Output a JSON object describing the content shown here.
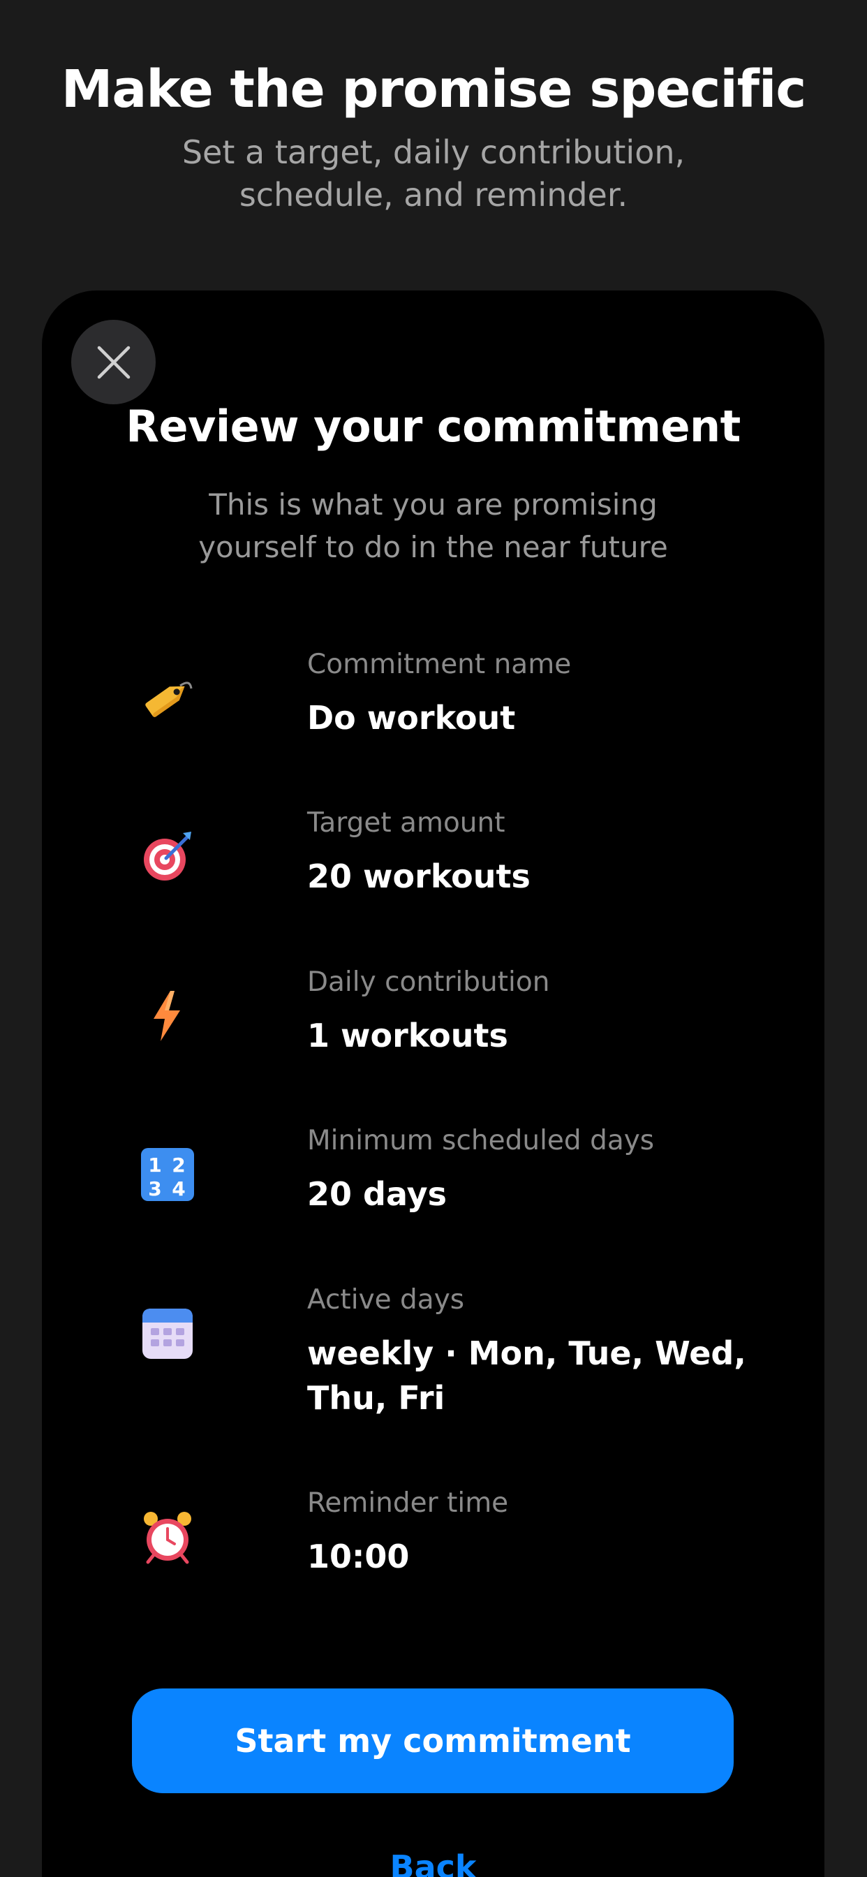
{
  "header": {
    "title": "Make the promise specific",
    "subtitle": "Set a target, daily contribution, schedule, and reminder."
  },
  "sheet": {
    "title": "Review your commitment",
    "subtitle": "This is what you are promising yourself to do in the near future",
    "rows": [
      {
        "icon": "tag-icon",
        "label": "Commitment name",
        "value": "Do workout"
      },
      {
        "icon": "target-icon",
        "label": "Target amount",
        "value": "20 workouts"
      },
      {
        "icon": "lightning-icon",
        "label": "Daily contribution",
        "value": "1 workouts"
      },
      {
        "icon": "numbers-icon",
        "label": "Minimum scheduled days",
        "value": "20 days",
        "icon_text": [
          "1",
          "2",
          "3",
          "4"
        ]
      },
      {
        "icon": "calendar-icon",
        "label": "Active days",
        "value": "weekly · Mon, Tue, Wed, Thu, Fri"
      },
      {
        "icon": "alarm-clock-icon",
        "label": "Reminder time",
        "value": "10:00"
      }
    ],
    "primary_button": "Start my commitment",
    "back_link": "Back"
  },
  "colors": {
    "background": "#1b1b1b",
    "sheet": "#000000",
    "accent": "#0a84ff",
    "muted_text": "#8a8a8a"
  }
}
